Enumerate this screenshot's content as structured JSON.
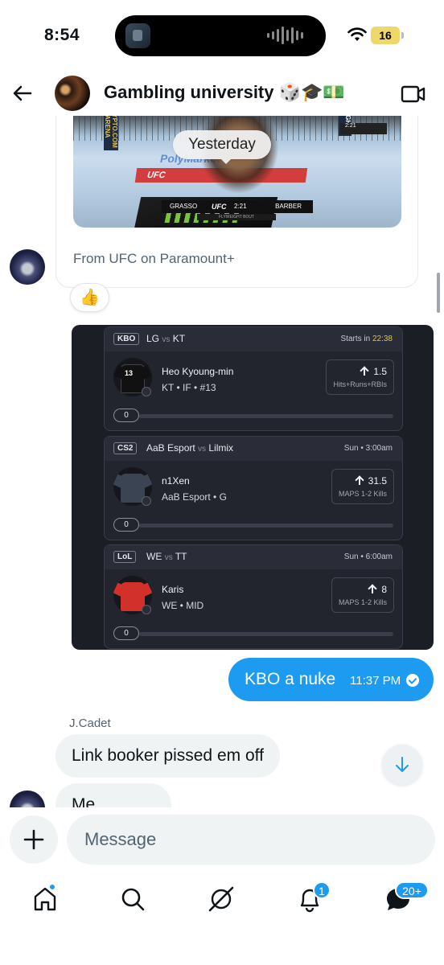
{
  "status_bar": {
    "time": "8:54",
    "battery": "16"
  },
  "header": {
    "title": "Gambling university 🎲🎓💵",
    "back_icon": "arrow-left-icon",
    "video_icon": "video-camera-icon"
  },
  "chat": {
    "date_separator": "Yesterday",
    "media_card": {
      "source": "From UFC on Paramount+",
      "video": {
        "fighter_left": "GRASSO",
        "fighter_right": "BARBER",
        "clock": "2:21",
        "league": "UFC",
        "bout": "FLYWEIGHT BOUT",
        "sponsor": "PolyMarket",
        "banner_left": "CRYPTO.COM ARENA",
        "banner_right": "FIGHT",
        "scoreboard": "2:21"
      }
    },
    "reaction": "👍",
    "props": [
      {
        "league": "KBO",
        "team1": "LG",
        "team2": "KT",
        "when_prefix": "Starts in ",
        "when_value": "22:38",
        "player": "Heo Kyoung-min",
        "meta": "KT • IF • #13",
        "jersey_number": "13",
        "stat_value": "1.5",
        "stat_label": "Hits+Runs+RBIs",
        "picks": "0",
        "jersey_color": "#111111"
      },
      {
        "league": "CS2",
        "team1": "AaB Esport",
        "team2": "Lilmix",
        "when_prefix": "Sun • 3:00am",
        "when_value": "",
        "player": "n1Xen",
        "meta": "AaB Esport • G",
        "jersey_number": "",
        "stat_value": "31.5",
        "stat_label": "MAPS 1-2 Kills",
        "picks": "0",
        "jersey_color": "#3b4453"
      },
      {
        "league": "LoL",
        "team1": "WE",
        "team2": "TT",
        "when_prefix": "Sun • 6:00am",
        "when_value": "",
        "player": "Karis",
        "meta": "WE • MID",
        "jersey_number": "",
        "stat_value": "8",
        "stat_label": "MAPS 1-2 Kills",
        "picks": "0",
        "jersey_color": "#d2302a"
      }
    ],
    "vs_label": "vs",
    "outgoing": {
      "text": "KBO a nuke",
      "time": "11:37 PM"
    },
    "sender_name": "J.Cadet",
    "incoming": [
      "Link booker pissed em off",
      "Me"
    ]
  },
  "composer": {
    "placeholder": "Message"
  },
  "tabbar": {
    "notifications_badge": "1",
    "messages_badge": "20+"
  },
  "colors": {
    "accent": "#1d9bf0",
    "props_bg": "#1c1e26",
    "countdown": "#e8c23a"
  }
}
